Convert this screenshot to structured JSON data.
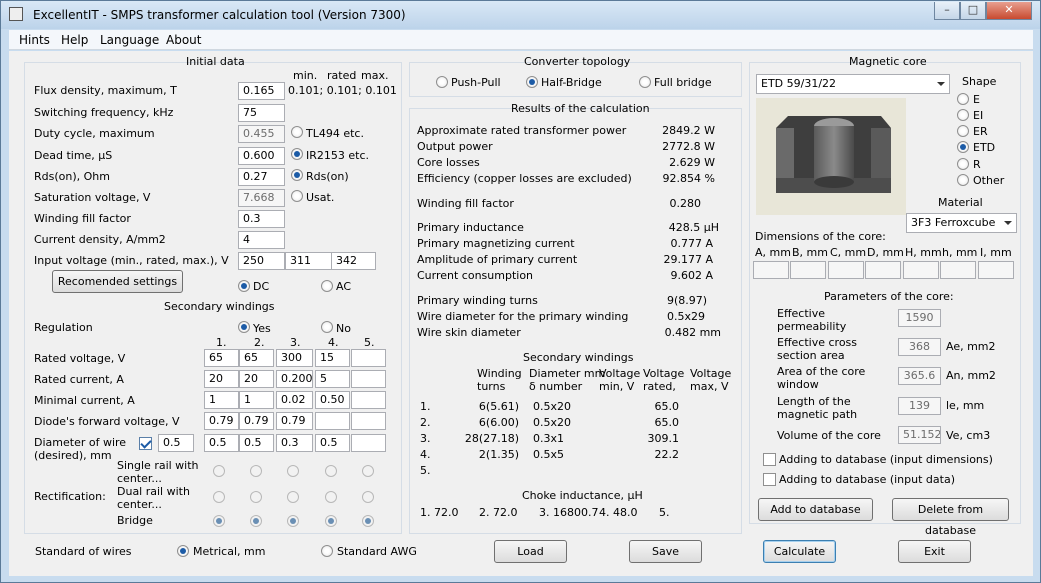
{
  "window": {
    "title": "ExcellentIT - SMPS transformer calculation tool (Version 7300)"
  },
  "menu": [
    "Hints",
    "Help",
    "Language",
    "About"
  ],
  "initial": {
    "title": "Initial data",
    "hdr_min": "min.",
    "hdr_rated": "rated",
    "hdr_max": "max.",
    "flux_label": "Flux density, maximum, T",
    "flux": "0.165",
    "flux_range": "0.101; 0.101; 0.101",
    "freq_label": "Switching frequency, kHz",
    "freq": "75",
    "duty_label": "Duty cycle, maximum",
    "duty": "0.455",
    "duty_opt": "TL494 etc.",
    "dead_label": "Dead time, µS",
    "dead": "0.600",
    "dead_opt": "IR2153 etc.",
    "rds_label": "Rds(on), Ohm",
    "rds": "0.27",
    "rds_opt": "Rds(on)",
    "sat_label": "Saturation voltage, V",
    "sat": "7.668",
    "sat_opt": "Usat.",
    "fill_label": "Winding fill factor",
    "fill": "0.3",
    "cur_label": "Current density, A/mm2",
    "cur": "4",
    "vin_label": "Input voltage (min., rated, max.), V",
    "vin_min": "250",
    "vin_rated": "311",
    "vin_max": "342",
    "recommended": "Recomended settings",
    "dc": "DC",
    "ac": "AC"
  },
  "secondary": {
    "title": "Secondary windings",
    "regulation": "Regulation",
    "yes": "Yes",
    "no": "No",
    "cols": [
      "1.",
      "2.",
      "3.",
      "4.",
      "5."
    ],
    "rated_v_label": "Rated voltage, V",
    "rated_v": [
      "65",
      "65",
      "300",
      "15",
      ""
    ],
    "rated_i_label": "Rated current, A",
    "rated_i": [
      "20",
      "20",
      "0.200",
      "5",
      ""
    ],
    "min_i_label": "Minimal current, A",
    "min_i": [
      "1",
      "1",
      "0.02",
      "0.50",
      ""
    ],
    "diode_label": "Diode's forward voltage, V",
    "diode": [
      "0.79",
      "0.79",
      "0.79",
      "",
      ""
    ],
    "diam_label1": "Diameter of wire",
    "diam_label2": "(desired), mm",
    "diam_default": "0.5",
    "diam": [
      "0.5",
      "0.5",
      "0.3",
      "0.5",
      ""
    ],
    "single_rail1": "Single rail with",
    "single_rail2": "center...",
    "dual_rail1": "Dual rail with",
    "dual_rail2": "center...",
    "bridge": "Bridge",
    "rectification": "Rectification:"
  },
  "topology": {
    "title": "Converter topology",
    "options": [
      "Push-Pull",
      "Half-Bridge",
      "Full bridge"
    ]
  },
  "results": {
    "title": "Results of the calculation",
    "rows1": [
      {
        "label": "Approximate rated transformer power",
        "value": "2849.2 W"
      },
      {
        "label": "Output power",
        "value": "2772.8 W"
      },
      {
        "label": "Core losses",
        "value": "2.629 W"
      },
      {
        "label": "Efficiency (copper losses are excluded)",
        "value": "92.854 %"
      }
    ],
    "fill_label": "Winding fill factor",
    "fill_value": "0.280",
    "rows2": [
      {
        "label": "Primary inductance",
        "value": "428.5 µH"
      },
      {
        "label": "Primary magnetizing current",
        "value": "0.777 A"
      },
      {
        "label": "Amplitude of primary current",
        "value": "29.177 A"
      },
      {
        "label": "Current consumption",
        "value": "9.602 A"
      }
    ],
    "rows3": [
      {
        "label": "Primary winding turns",
        "value": "9(8.97)"
      },
      {
        "label": "Wire diameter for the primary winding",
        "value": "0.5x29"
      },
      {
        "label": "Wire skin diameter",
        "value": "0.482 mm"
      }
    ],
    "sec_title": "Secondary windings",
    "sec_hdr": [
      "Winding",
      "turns",
      "Diameter mm",
      "δ number",
      "Voltage",
      "min, V",
      "Voltage",
      "rated,",
      "Voltage",
      "max, V"
    ],
    "sec_rows": [
      {
        "n": "1.",
        "turns": "6(5.61)",
        "diam": "0.5x20",
        "vrated": "65.0"
      },
      {
        "n": "2.",
        "turns": "6(6.00)",
        "diam": "0.5x20",
        "vrated": "65.0"
      },
      {
        "n": "3.",
        "turns": "28(27.18)",
        "diam": "0.3x1",
        "vrated": "309.1"
      },
      {
        "n": "4.",
        "turns": "2(1.35)",
        "diam": "0.5x5",
        "vrated": "22.2"
      },
      {
        "n": "5.",
        "turns": "",
        "diam": "",
        "vrated": ""
      }
    ],
    "choke_title": "Choke inductance, µH",
    "choke": [
      "1. 72.0",
      "2. 72.0",
      "3. 16800.7",
      "4. 48.0",
      "5."
    ]
  },
  "core": {
    "title": "Magnetic core",
    "selected": "ETD 59/31/22",
    "shape_title": "Shape",
    "shapes": [
      "E",
      "EI",
      "ER",
      "ETD",
      "R",
      "Other"
    ],
    "material_title": "Material",
    "material": "3F3 Ferroxcube",
    "dims_title": "Dimensions of the core:",
    "dims": [
      "A, mm",
      "B, mm",
      "C, mm",
      "D, mm",
      "H, mm",
      "h, mm",
      "I, mm"
    ],
    "params_title": "Parameters of the core:",
    "perm1": "Effective",
    "perm2": "permeability",
    "perm": "1590",
    "ae1": "Effective cross",
    "ae2": "section area",
    "ae": "368",
    "ae_unit": "Ae, mm2",
    "an1": "Area of the core",
    "an2": "window",
    "an": "365.6",
    "an_unit": "An, mm2",
    "le1": "Length of the",
    "le2": "magnetic path",
    "le": "139",
    "le_unit": "le, mm",
    "ve_label": "Volume of the core",
    "ve": "51.152",
    "ve_unit": "Ve, cm3",
    "db_dims": "Adding to database (input dimensions)",
    "db_data": "Adding to database (input data)",
    "add_db": "Add to database",
    "del_db": "Delete from database"
  },
  "bottom": {
    "wires": "Standard of wires",
    "metric": "Metrical, mm",
    "awg": "Standard AWG",
    "load": "Load",
    "save": "Save",
    "calculate": "Calculate",
    "exit": "Exit"
  }
}
